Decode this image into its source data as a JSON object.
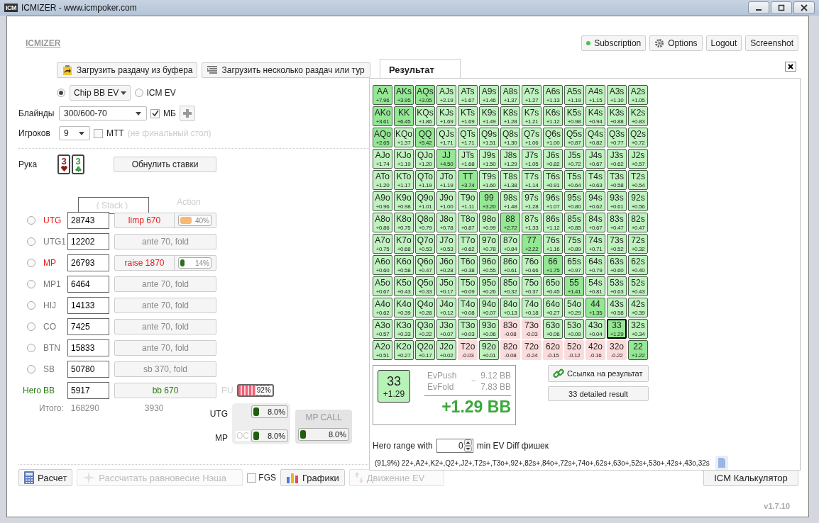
{
  "window": {
    "icon": "ICM",
    "title": "ICMIZER - www.icmpoker.com"
  },
  "header": {
    "brand": "ICMIZER",
    "buttons": [
      {
        "label": "Subscription",
        "kind": "status"
      },
      {
        "label": "Options",
        "kind": "gear"
      },
      {
        "label": "Logout",
        "kind": "plain"
      },
      {
        "label": "Screenshot",
        "kind": "plain"
      }
    ]
  },
  "load_buttons": [
    {
      "label": "Загрузить раздачу из буфера",
      "kind": "clipboard"
    },
    {
      "label": "Загрузить несколько раздач или тур",
      "kind": "list"
    }
  ],
  "mode": [
    {
      "label": "Chip BB EV",
      "kind": "dropdown",
      "selected": true
    },
    {
      "label": "ICM EV",
      "kind": "plain",
      "selected": false
    }
  ],
  "blinds": {
    "label": "Блайнды",
    "value": "300/600-70",
    "ante_label": "МБ",
    "ante_checked": true
  },
  "players_count": {
    "label": "Игроков",
    "value": "9",
    "mtt_label": "MTT",
    "mtt_checked": false,
    "mtt_hint": "(не финальный стол)"
  },
  "hand": {
    "label": "Рука",
    "cards": [
      {
        "rank": "3",
        "kind": "hearts"
      },
      {
        "rank": "3",
        "kind": "clubs"
      }
    ],
    "reset_button": "Обнулить ставки"
  },
  "columns": [
    "Stack",
    "Action"
  ],
  "players": [
    {
      "position": "UTG",
      "kind": "active",
      "selected": false,
      "stack": "28743",
      "action": "limp 670",
      "range": {
        "level": 0.4,
        "text": "40%",
        "color": "#f8b878"
      }
    },
    {
      "position": "UTG1",
      "kind": "folded",
      "selected": false,
      "stack": "12202",
      "action": "ante 70, fold"
    },
    {
      "position": "MP",
      "kind": "active",
      "selected": false,
      "stack": "26793",
      "action": "raise 1870",
      "range": {
        "level": 0.14,
        "text": "14%",
        "color": "#2e6e1e"
      }
    },
    {
      "position": "MP1",
      "kind": "folded",
      "selected": false,
      "stack": "6464",
      "action": "ante 70, fold"
    },
    {
      "position": "HIJ",
      "kind": "folded",
      "selected": false,
      "stack": "14133",
      "action": "ante 70, fold"
    },
    {
      "position": "CO",
      "kind": "folded",
      "selected": false,
      "stack": "7425",
      "action": "ante 70, fold"
    },
    {
      "position": "BTN",
      "kind": "folded",
      "selected": false,
      "stack": "15833",
      "action": "ante 70, fold"
    },
    {
      "position": "SB",
      "kind": "folded",
      "selected": false,
      "stack": "50780",
      "action": "sb 370, fold"
    },
    {
      "position": "BB",
      "kind": "hero",
      "tag": "Hero",
      "stack": "5917",
      "action": "bb 670",
      "extra": {
        "label": "PU",
        "level": 0.92,
        "text": "92%",
        "color": "#f06078"
      }
    }
  ],
  "totals": {
    "label": "Итого:",
    "stack": "168290",
    "action": "3930"
  },
  "ranges": [
    {
      "label": "UTG",
      "level": 0.08,
      "text": "8.0%"
    },
    {
      "label": "MP",
      "tag": "OC",
      "level": 0.08,
      "text": "8.0%"
    }
  ],
  "call_range": {
    "title": "MP CALL",
    "level": 0.08,
    "text": "8.0%"
  },
  "toolbar": [
    {
      "label": "Расчет",
      "kind": "calculator",
      "disabled": false
    },
    {
      "label": "Рассчитать равновесие Нэша",
      "kind": "nash",
      "disabled": true
    },
    {
      "label": "FGS",
      "kind": "checkbox",
      "checked": false
    },
    {
      "label": "Графики",
      "kind": "chart",
      "disabled": false
    },
    {
      "label": "Движение EV",
      "kind": "arrows",
      "disabled": true
    }
  ],
  "icm_calculator": "ICM Калькулятор",
  "version": "v1.7.10",
  "result": {
    "tab": "Результат",
    "grid": [
      [
        {
          "hand": "AA",
          "ev": "+7.96",
          "kind": "strong",
          "selected": false
        },
        {
          "hand": "AKs",
          "ev": "+3.95",
          "kind": "strong",
          "selected": false
        },
        {
          "hand": "AQs",
          "ev": "+3.05",
          "kind": "strong",
          "selected": false
        },
        {
          "hand": "AJs",
          "ev": "+2.19",
          "kind": "plain",
          "selected": false
        },
        {
          "hand": "ATs",
          "ev": "+1.67",
          "kind": "plain",
          "selected": false
        },
        {
          "hand": "A9s",
          "ev": "+1.46",
          "kind": "plain",
          "selected": false
        },
        {
          "hand": "A8s",
          "ev": "+1.37",
          "kind": "plain",
          "selected": false
        },
        {
          "hand": "A7s",
          "ev": "+1.27",
          "kind": "plain",
          "selected": false
        },
        {
          "hand": "A6s",
          "ev": "+1.13",
          "kind": "plain",
          "selected": false
        },
        {
          "hand": "A5s",
          "ev": "+1.19",
          "kind": "plain",
          "selected": false
        },
        {
          "hand": "A4s",
          "ev": "+1.15",
          "kind": "plain",
          "selected": false
        },
        {
          "hand": "A3s",
          "ev": "+1.10",
          "kind": "plain",
          "selected": false
        },
        {
          "hand": "A2s",
          "ev": "+1.05",
          "kind": "plain",
          "selected": false
        }
      ],
      [
        {
          "hand": "AKo",
          "ev": "+3.61",
          "kind": "strong",
          "selected": false
        },
        {
          "hand": "KK",
          "ev": "+6.45",
          "kind": "strong",
          "selected": false
        },
        {
          "hand": "KQs",
          "ev": "+1.86",
          "kind": "plain",
          "selected": false
        },
        {
          "hand": "KJs",
          "ev": "+1.69",
          "kind": "plain",
          "selected": false
        },
        {
          "hand": "KTs",
          "ev": "+1.69",
          "kind": "plain",
          "selected": false
        },
        {
          "hand": "K9s",
          "ev": "+1.49",
          "kind": "plain",
          "selected": false
        },
        {
          "hand": "K8s",
          "ev": "+1.28",
          "kind": "plain",
          "selected": false
        },
        {
          "hand": "K7s",
          "ev": "+1.21",
          "kind": "plain",
          "selected": false
        },
        {
          "hand": "K6s",
          "ev": "+1.12",
          "kind": "plain",
          "selected": false
        },
        {
          "hand": "K5s",
          "ev": "+0.98",
          "kind": "plain",
          "selected": false
        },
        {
          "hand": "K4s",
          "ev": "+0.94",
          "kind": "plain",
          "selected": false
        },
        {
          "hand": "K3s",
          "ev": "+0.88",
          "kind": "plain",
          "selected": false
        },
        {
          "hand": "K2s",
          "ev": "+0.83",
          "kind": "plain",
          "selected": false
        }
      ],
      [
        {
          "hand": "AQo",
          "ev": "+2.65",
          "kind": "strong",
          "selected": false
        },
        {
          "hand": "KQo",
          "ev": "+1.37",
          "kind": "plain",
          "selected": false
        },
        {
          "hand": "QQ",
          "ev": "+5.42",
          "kind": "strong",
          "selected": false
        },
        {
          "hand": "QJs",
          "ev": "+1.71",
          "kind": "plain",
          "selected": false
        },
        {
          "hand": "QTs",
          "ev": "+1.71",
          "kind": "plain",
          "selected": false
        },
        {
          "hand": "Q9s",
          "ev": "+1.51",
          "kind": "plain",
          "selected": false
        },
        {
          "hand": "Q8s",
          "ev": "+1.30",
          "kind": "plain",
          "selected": false
        },
        {
          "hand": "Q7s",
          "ev": "+1.06",
          "kind": "plain",
          "selected": false
        },
        {
          "hand": "Q6s",
          "ev": "+1.00",
          "kind": "plain",
          "selected": false
        },
        {
          "hand": "Q5s",
          "ev": "+0.87",
          "kind": "plain",
          "selected": false
        },
        {
          "hand": "Q4s",
          "ev": "+0.82",
          "kind": "plain",
          "selected": false
        },
        {
          "hand": "Q3s",
          "ev": "+0.77",
          "kind": "plain",
          "selected": false
        },
        {
          "hand": "Q2s",
          "ev": "+0.72",
          "kind": "plain",
          "selected": false
        }
      ],
      [
        {
          "hand": "AJo",
          "ev": "+1.74",
          "kind": "plain",
          "selected": false
        },
        {
          "hand": "KJo",
          "ev": "+1.19",
          "kind": "plain",
          "selected": false
        },
        {
          "hand": "QJo",
          "ev": "+1.20",
          "kind": "plain",
          "selected": false
        },
        {
          "hand": "JJ",
          "ev": "+4.50",
          "kind": "strong",
          "selected": false
        },
        {
          "hand": "JTs",
          "ev": "+1.68",
          "kind": "plain",
          "selected": false
        },
        {
          "hand": "J9s",
          "ev": "+1.50",
          "kind": "plain",
          "selected": false
        },
        {
          "hand": "J8s",
          "ev": "+1.29",
          "kind": "plain",
          "selected": false
        },
        {
          "hand": "J7s",
          "ev": "+1.05",
          "kind": "plain",
          "selected": false
        },
        {
          "hand": "J6s",
          "ev": "+0.82",
          "kind": "plain",
          "selected": false
        },
        {
          "hand": "J5s",
          "ev": "+0.72",
          "kind": "plain",
          "selected": false
        },
        {
          "hand": "J4s",
          "ev": "+0.67",
          "kind": "plain",
          "selected": false
        },
        {
          "hand": "J3s",
          "ev": "+0.62",
          "kind": "plain",
          "selected": false
        },
        {
          "hand": "J2s",
          "ev": "+0.57",
          "kind": "plain",
          "selected": false
        }
      ],
      [
        {
          "hand": "ATo",
          "ev": "+1.20",
          "kind": "plain",
          "selected": false
        },
        {
          "hand": "KTo",
          "ev": "+1.17",
          "kind": "plain",
          "selected": false
        },
        {
          "hand": "QTo",
          "ev": "+1.19",
          "kind": "plain",
          "selected": false
        },
        {
          "hand": "JTo",
          "ev": "+1.19",
          "kind": "plain",
          "selected": false
        },
        {
          "hand": "TT",
          "ev": "+3.74",
          "kind": "strong",
          "selected": false
        },
        {
          "hand": "T9s",
          "ev": "+1.60",
          "kind": "plain",
          "selected": false
        },
        {
          "hand": "T8s",
          "ev": "+1.38",
          "kind": "plain",
          "selected": false
        },
        {
          "hand": "T7s",
          "ev": "+1.14",
          "kind": "plain",
          "selected": false
        },
        {
          "hand": "T6s",
          "ev": "+0.91",
          "kind": "plain",
          "selected": false
        },
        {
          "hand": "T5s",
          "ev": "+0.64",
          "kind": "plain",
          "selected": false
        },
        {
          "hand": "T4s",
          "ev": "+0.63",
          "kind": "plain",
          "selected": false
        },
        {
          "hand": "T3s",
          "ev": "+0.58",
          "kind": "plain",
          "selected": false
        },
        {
          "hand": "T2s",
          "ev": "+0.54",
          "kind": "plain",
          "selected": false
        }
      ],
      [
        {
          "hand": "A9o",
          "ev": "+0.96",
          "kind": "plain",
          "selected": false
        },
        {
          "hand": "K9o",
          "ev": "+0.98",
          "kind": "plain",
          "selected": false
        },
        {
          "hand": "Q9o",
          "ev": "+1.01",
          "kind": "plain",
          "selected": false
        },
        {
          "hand": "J9o",
          "ev": "+1.00",
          "kind": "plain",
          "selected": false
        },
        {
          "hand": "T9o",
          "ev": "+1.11",
          "kind": "plain",
          "selected": false
        },
        {
          "hand": "99",
          "ev": "+3.20",
          "kind": "strong",
          "selected": false
        },
        {
          "hand": "98s",
          "ev": "+1.48",
          "kind": "plain",
          "selected": false
        },
        {
          "hand": "97s",
          "ev": "+1.28",
          "kind": "plain",
          "selected": false
        },
        {
          "hand": "96s",
          "ev": "+1.07",
          "kind": "plain",
          "selected": false
        },
        {
          "hand": "95s",
          "ev": "+0.80",
          "kind": "plain",
          "selected": false
        },
        {
          "hand": "94s",
          "ev": "+0.62",
          "kind": "plain",
          "selected": false
        },
        {
          "hand": "93s",
          "ev": "+0.61",
          "kind": "plain",
          "selected": false
        },
        {
          "hand": "92s",
          "ev": "+0.56",
          "kind": "plain",
          "selected": false
        }
      ],
      [
        {
          "hand": "A8o",
          "ev": "+0.86",
          "kind": "plain",
          "selected": false
        },
        {
          "hand": "K8o",
          "ev": "+0.75",
          "kind": "plain",
          "selected": false
        },
        {
          "hand": "Q8o",
          "ev": "+0.79",
          "kind": "plain",
          "selected": false
        },
        {
          "hand": "J8o",
          "ev": "+0.78",
          "kind": "plain",
          "selected": false
        },
        {
          "hand": "T8o",
          "ev": "+0.87",
          "kind": "plain",
          "selected": false
        },
        {
          "hand": "98o",
          "ev": "+0.99",
          "kind": "plain",
          "selected": false
        },
        {
          "hand": "88",
          "ev": "+2.72",
          "kind": "strong",
          "selected": false
        },
        {
          "hand": "87s",
          "ev": "+1.33",
          "kind": "plain",
          "selected": false
        },
        {
          "hand": "86s",
          "ev": "+1.12",
          "kind": "plain",
          "selected": false
        },
        {
          "hand": "85s",
          "ev": "+0.85",
          "kind": "plain",
          "selected": false
        },
        {
          "hand": "84s",
          "ev": "+0.67",
          "kind": "plain",
          "selected": false
        },
        {
          "hand": "83s",
          "ev": "+0.47",
          "kind": "plain",
          "selected": false
        },
        {
          "hand": "82s",
          "ev": "+0.47",
          "kind": "plain",
          "selected": false
        }
      ],
      [
        {
          "hand": "A7o",
          "ev": "+0.75",
          "kind": "plain",
          "selected": false
        },
        {
          "hand": "K7o",
          "ev": "+0.68",
          "kind": "plain",
          "selected": false
        },
        {
          "hand": "Q7o",
          "ev": "+0.53",
          "kind": "plain",
          "selected": false
        },
        {
          "hand": "J7o",
          "ev": "+0.53",
          "kind": "plain",
          "selected": false
        },
        {
          "hand": "T7o",
          "ev": "+0.62",
          "kind": "plain",
          "selected": false
        },
        {
          "hand": "97o",
          "ev": "+0.78",
          "kind": "plain",
          "selected": false
        },
        {
          "hand": "87o",
          "ev": "+0.84",
          "kind": "plain",
          "selected": false
        },
        {
          "hand": "77",
          "ev": "+2.22",
          "kind": "strong",
          "selected": false
        },
        {
          "hand": "76s",
          "ev": "+1.16",
          "kind": "plain",
          "selected": false
        },
        {
          "hand": "75s",
          "ev": "+0.89",
          "kind": "plain",
          "selected": false
        },
        {
          "hand": "74s",
          "ev": "+0.71",
          "kind": "plain",
          "selected": false
        },
        {
          "hand": "73s",
          "ev": "+0.52",
          "kind": "plain",
          "selected": false
        },
        {
          "hand": "72s",
          "ev": "+0.32",
          "kind": "plain",
          "selected": false
        }
      ],
      [
        {
          "hand": "A6o",
          "ev": "+0.60",
          "kind": "plain",
          "selected": false
        },
        {
          "hand": "K6o",
          "ev": "+0.58",
          "kind": "plain",
          "selected": false
        },
        {
          "hand": "Q6o",
          "ev": "+0.47",
          "kind": "plain",
          "selected": false
        },
        {
          "hand": "J6o",
          "ev": "+0.28",
          "kind": "plain",
          "selected": false
        },
        {
          "hand": "T6o",
          "ev": "+0.38",
          "kind": "plain",
          "selected": false
        },
        {
          "hand": "96o",
          "ev": "+0.55",
          "kind": "plain",
          "selected": false
        },
        {
          "hand": "86o",
          "ev": "+0.61",
          "kind": "plain",
          "selected": false
        },
        {
          "hand": "76o",
          "ev": "+0.66",
          "kind": "plain",
          "selected": false
        },
        {
          "hand": "66",
          "ev": "+1.75",
          "kind": "strong",
          "selected": false
        },
        {
          "hand": "65s",
          "ev": "+0.97",
          "kind": "plain",
          "selected": false
        },
        {
          "hand": "64s",
          "ev": "+0.79",
          "kind": "plain",
          "selected": false
        },
        {
          "hand": "63s",
          "ev": "+0.60",
          "kind": "plain",
          "selected": false
        },
        {
          "hand": "62s",
          "ev": "+0.40",
          "kind": "plain",
          "selected": false
        }
      ],
      [
        {
          "hand": "A5o",
          "ev": "+0.67",
          "kind": "plain",
          "selected": false
        },
        {
          "hand": "K5o",
          "ev": "+0.43",
          "kind": "plain",
          "selected": false
        },
        {
          "hand": "Q5o",
          "ev": "+0.33",
          "kind": "plain",
          "selected": false
        },
        {
          "hand": "J5o",
          "ev": "+0.17",
          "kind": "plain",
          "selected": false
        },
        {
          "hand": "T5o",
          "ev": "+0.09",
          "kind": "plain",
          "selected": false
        },
        {
          "hand": "95o",
          "ev": "+0.26",
          "kind": "plain",
          "selected": false
        },
        {
          "hand": "85o",
          "ev": "+0.32",
          "kind": "plain",
          "selected": false
        },
        {
          "hand": "75o",
          "ev": "+0.37",
          "kind": "plain",
          "selected": false
        },
        {
          "hand": "65o",
          "ev": "+0.45",
          "kind": "plain",
          "selected": false
        },
        {
          "hand": "55",
          "ev": "+1.41",
          "kind": "strong",
          "selected": false
        },
        {
          "hand": "54s",
          "ev": "+0.81",
          "kind": "plain",
          "selected": false
        },
        {
          "hand": "53s",
          "ev": "+0.63",
          "kind": "plain",
          "selected": false
        },
        {
          "hand": "52s",
          "ev": "+0.43",
          "kind": "plain",
          "selected": false
        }
      ],
      [
        {
          "hand": "A4o",
          "ev": "+0.62",
          "kind": "plain",
          "selected": false
        },
        {
          "hand": "K4o",
          "ev": "+0.39",
          "kind": "plain",
          "selected": false
        },
        {
          "hand": "Q4o",
          "ev": "+0.28",
          "kind": "plain",
          "selected": false
        },
        {
          "hand": "J4o",
          "ev": "+0.12",
          "kind": "plain",
          "selected": false
        },
        {
          "hand": "T4o",
          "ev": "+0.08",
          "kind": "plain",
          "selected": false
        },
        {
          "hand": "94o",
          "ev": "+0.07",
          "kind": "plain",
          "selected": false
        },
        {
          "hand": "84o",
          "ev": "+0.13",
          "kind": "plain",
          "selected": false
        },
        {
          "hand": "74o",
          "ev": "+0.18",
          "kind": "plain",
          "selected": false
        },
        {
          "hand": "64o",
          "ev": "+0.27",
          "kind": "plain",
          "selected": false
        },
        {
          "hand": "54o",
          "ev": "+0.29",
          "kind": "plain",
          "selected": false
        },
        {
          "hand": "44",
          "ev": "+1.35",
          "kind": "strong",
          "selected": false
        },
        {
          "hand": "43s",
          "ev": "+0.58",
          "kind": "plain",
          "selected": false
        },
        {
          "hand": "42s",
          "ev": "+0.39",
          "kind": "plain",
          "selected": false
        }
      ],
      [
        {
          "hand": "A3o",
          "ev": "+0.57",
          "kind": "plain",
          "selected": false
        },
        {
          "hand": "K3o",
          "ev": "+0.33",
          "kind": "plain",
          "selected": false
        },
        {
          "hand": "Q3o",
          "ev": "+0.22",
          "kind": "plain",
          "selected": false
        },
        {
          "hand": "J3o",
          "ev": "+0.07",
          "kind": "plain",
          "selected": false
        },
        {
          "hand": "T3o",
          "ev": "+0.03",
          "kind": "plain",
          "selected": false
        },
        {
          "hand": "93o",
          "ev": "+0.06",
          "kind": "plain",
          "selected": false
        },
        {
          "hand": "83o",
          "ev": "-0.08",
          "kind": "minus",
          "selected": false
        },
        {
          "hand": "73o",
          "ev": "-0.03",
          "kind": "minus",
          "selected": false
        },
        {
          "hand": "63o",
          "ev": "+0.06",
          "kind": "plain",
          "selected": false
        },
        {
          "hand": "53o",
          "ev": "+0.09",
          "kind": "plain",
          "selected": false
        },
        {
          "hand": "43o",
          "ev": "+0.04",
          "kind": "plain",
          "selected": false
        },
        {
          "hand": "33",
          "ev": "+1.29",
          "kind": "strong",
          "selected": true
        },
        {
          "hand": "32s",
          "ev": "+0.34",
          "kind": "plain",
          "selected": false
        }
      ],
      [
        {
          "hand": "A2o",
          "ev": "+0.51",
          "kind": "plain",
          "selected": false
        },
        {
          "hand": "K2o",
          "ev": "+0.27",
          "kind": "plain",
          "selected": false
        },
        {
          "hand": "Q2o",
          "ev": "+0.17",
          "kind": "plain",
          "selected": false
        },
        {
          "hand": "J2o",
          "ev": "+0.02",
          "kind": "plain",
          "selected": false
        },
        {
          "hand": "T2o",
          "ev": "-0.03",
          "kind": "minus",
          "selected": false
        },
        {
          "hand": "92o",
          "ev": "+0.01",
          "kind": "plain",
          "selected": false
        },
        {
          "hand": "82o",
          "ev": "-0.08",
          "kind": "minus",
          "selected": false
        },
        {
          "hand": "72o",
          "ev": "-0.24",
          "kind": "minus",
          "selected": false
        },
        {
          "hand": "62o",
          "ev": "-0.15",
          "kind": "minus",
          "selected": false
        },
        {
          "hand": "52o",
          "ev": "-0.12",
          "kind": "minus",
          "selected": false
        },
        {
          "hand": "42o",
          "ev": "-0.16",
          "kind": "minus",
          "selected": false
        },
        {
          "hand": "32o",
          "ev": "-0.22",
          "kind": "minus",
          "selected": false
        },
        {
          "hand": "22",
          "ev": "+1.22",
          "kind": "strong",
          "selected": false
        }
      ]
    ],
    "summary": {
      "hand": "33",
      "ev": "+1.29",
      "push_label": "EvPush",
      "push_value": "9.12 BB",
      "fold_label": "EvFold",
      "fold_value": "7.83 BB",
      "operator": "−",
      "total": "+1.29 BB"
    },
    "link_button": "Ссылка на результат",
    "detail_button": "33 detailed result",
    "range_label": "Hero range with",
    "min_ev": "0",
    "range_suffix": "min EV Diff фишек",
    "range_text": "(91,9%) 22+,A2+,K2+,Q2+,J2+,T2s+,T3o+,92+,82s+,84o+,72s+,74o+,62s+,63o+,52s+,53o+,42s+,43o,32s"
  }
}
